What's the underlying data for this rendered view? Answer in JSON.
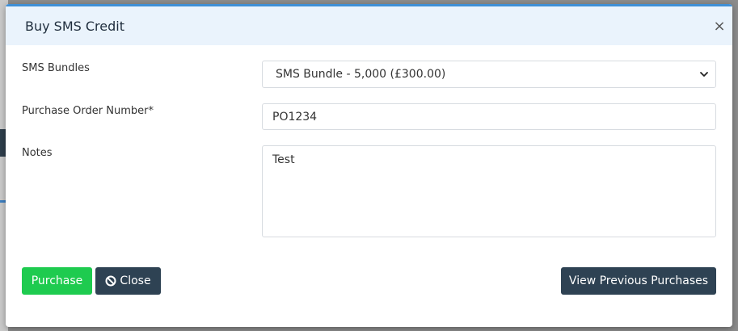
{
  "modal": {
    "title": "Buy SMS Credit",
    "close_symbol": "×"
  },
  "form": {
    "sms_bundles_label": "SMS Bundles",
    "sms_bundles_value": "SMS Bundle - 5,000 (£300.00)",
    "po_label": "Purchase Order Number*",
    "po_value": "PO1234",
    "notes_label": "Notes",
    "notes_value": "Test"
  },
  "buttons": {
    "purchase": "Purchase",
    "close": "Close",
    "view_previous": "View Previous Purchases"
  },
  "icons": {
    "close": "close-icon",
    "chevron": "chevron-down-icon",
    "ban": "ban-icon"
  },
  "colors": {
    "header_bg": "#eaf3fc",
    "accent_top": "#3f8fd6",
    "purchase_green": "#1ecb4f",
    "dark_button": "#2e4253"
  }
}
